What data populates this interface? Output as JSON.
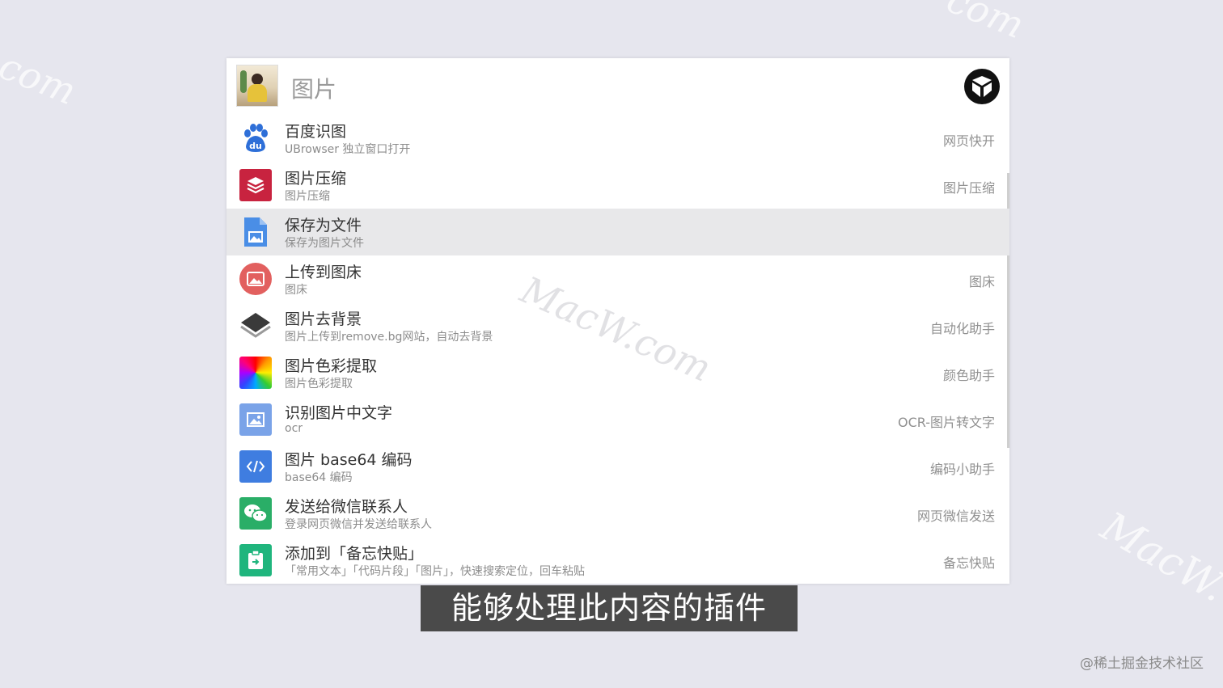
{
  "search": {
    "query": "图片"
  },
  "items": [
    {
      "title": "百度识图",
      "desc": "UBrowser 独立窗口打开",
      "right": "网页快开",
      "icon": "baidu-paw-icon",
      "color": "#2e6fd8"
    },
    {
      "title": "图片压缩",
      "desc": "图片压缩",
      "right": "图片压缩",
      "icon": "layers-compress-icon",
      "color": "#c8233f"
    },
    {
      "title": "保存为文件",
      "desc": "保存为图片文件",
      "right": "",
      "icon": "image-file-icon",
      "color": "#4a8ee6",
      "active": true
    },
    {
      "title": "上传到图床",
      "desc": "图床",
      "right": "图床",
      "icon": "image-upload-icon",
      "color": "#e2605f"
    },
    {
      "title": "图片去背景",
      "desc": "图片上传到remove.bg网站，自动去背景",
      "right": "自动化助手",
      "icon": "layer-stack-icon",
      "color": "#3a3a3a"
    },
    {
      "title": "图片色彩提取",
      "desc": "图片色彩提取",
      "right": "颜色助手",
      "icon": "color-wheel-icon",
      "color": "#ff6a00"
    },
    {
      "title": "识别图片中文字",
      "desc": "ocr",
      "right": "OCR-图片转文字",
      "icon": "ocr-image-icon",
      "color": "#7aa3e8"
    },
    {
      "title": "图片 base64 编码",
      "desc": "base64 编码",
      "right": "编码小助手",
      "icon": "code-icon",
      "color": "#3f7de0"
    },
    {
      "title": "发送给微信联系人",
      "desc": "登录网页微信并发送给联系人",
      "right": "网页微信发送",
      "icon": "wechat-icon",
      "color": "#2aae67"
    },
    {
      "title": "添加到「备忘快贴」",
      "desc": "「常用文本」「代码片段」「图片」，快速搜索定位，回车粘贴",
      "right": "备忘快贴",
      "icon": "clipboard-icon",
      "color": "#1fb57d"
    }
  ],
  "subtitle": "能够处理此内容的插件",
  "credit": "@稀土掘金技术社区",
  "watermarks": {
    "center": "MacW.com",
    "left": "com",
    "topright": "com",
    "right": "MacW."
  }
}
